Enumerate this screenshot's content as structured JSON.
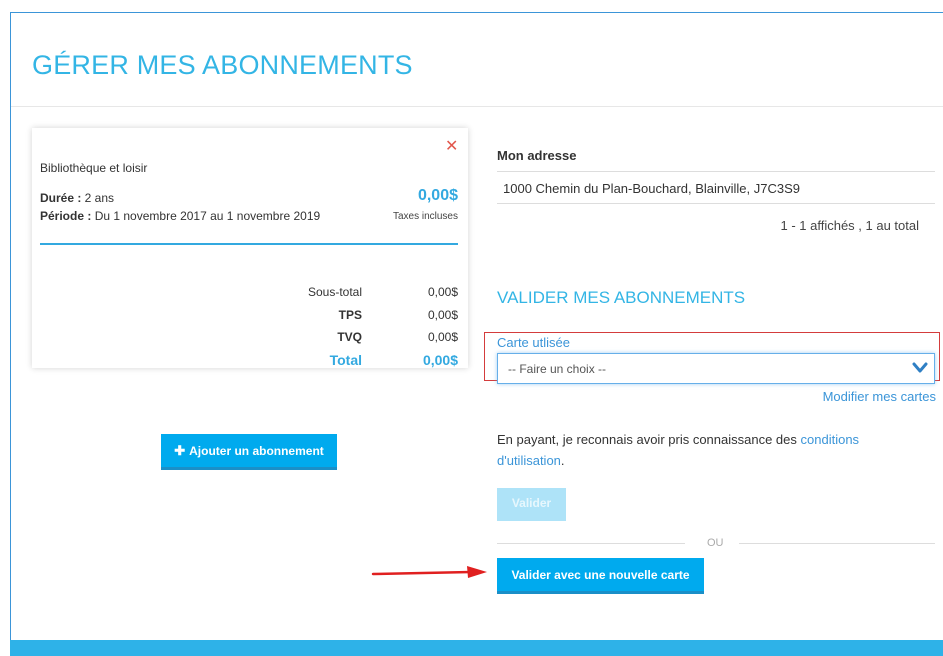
{
  "page": {
    "title": "GÉRER MES ABONNEMENTS"
  },
  "subscription": {
    "service": "Bibliothèque et loisir",
    "duree_label": "Durée :",
    "duree_value": " 2 ans",
    "periode_label": "Période :",
    "periode_value": " Du 1 novembre 2017 au 1 novembre 2019",
    "amount": "0,00$",
    "tax_note": "Taxes incluses",
    "close_icon": "close-icon",
    "totals": [
      {
        "label": "Sous-total",
        "value": "0,00$"
      },
      {
        "label": "TPS",
        "value": "0,00$"
      },
      {
        "label": "TVQ",
        "value": "0,00$"
      },
      {
        "label": "Total",
        "value": "0,00$"
      }
    ]
  },
  "add_button": {
    "icon": "plus-icon",
    "label": "Ajouter un abonnement"
  },
  "address": {
    "header": "Mon adresse",
    "value": "1000 Chemin du Plan-Bouchard, Blainville, J7C3S9",
    "count": "1 - 1 affichés , 1 au total"
  },
  "validate": {
    "title": "VALIDER MES ABONNEMENTS",
    "card_label": "Carte utlisée",
    "select_value": "-- Faire un choix --",
    "select_icon": "chevron-down-icon",
    "modify_link": "Modifier mes cartes",
    "consent_text": "En payant, je reconnais avoir pris connaissance des ",
    "consent_link": "conditions d'utilisation",
    "consent_end": ".",
    "valider_label": "Valider",
    "ou": "OU",
    "new_card_label": "Valider avec une nouvelle carte"
  },
  "colors": {
    "accent": "#33b5e5",
    "button": "#00aaee",
    "highlight_box": "#d43c3c",
    "arrow": "#e02020"
  }
}
